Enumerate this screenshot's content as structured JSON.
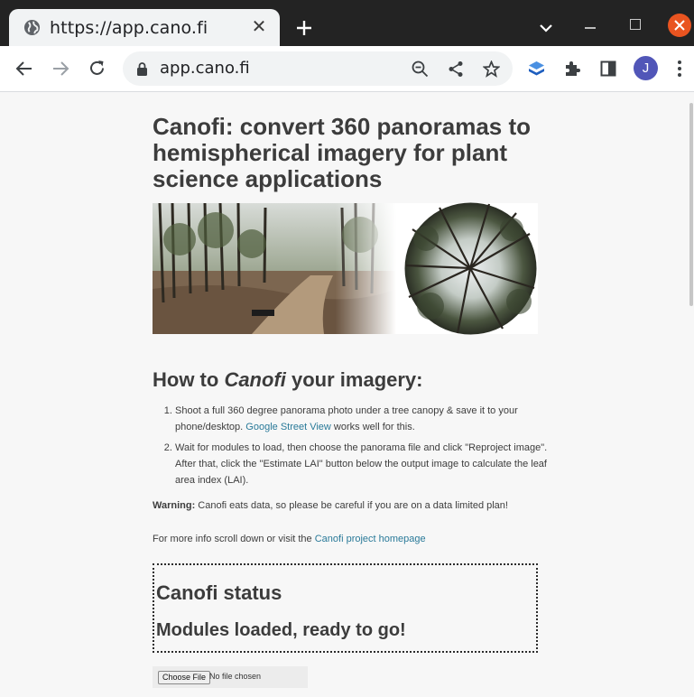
{
  "browser": {
    "tab_title": "https://app.cano.fi",
    "url": "app.cano.fi",
    "avatar_initial": "J",
    "colors": {
      "tabstrip": "#232323",
      "close_button": "#e95420",
      "avatar": "#5156b8"
    }
  },
  "page": {
    "title": "Canofi: convert 360 panoramas to hemispherical imagery for plant science applications",
    "howto": {
      "prefix": "How to ",
      "emphasis": "Canofi",
      "suffix": " your imagery:"
    },
    "steps": [
      {
        "text": "Shoot a full 360 degree panorama photo under a tree canopy & save it to your phone/desktop. ",
        "link": "Google Street View",
        "after": " works well for this."
      },
      {
        "text": "Wait for modules to load, then choose the panorama file and click \"Reproject image\". After that, click the \"Estimate LAI\" button below the output image to calculate the leaf area index (LAI)."
      }
    ],
    "warning": {
      "label": "Warning:",
      "text": " Canofi eats data, so please be careful if you are on a data limited plan!"
    },
    "moreinfo": {
      "text": "For more info scroll down or visit the ",
      "link": "Canofi project homepage"
    },
    "status": {
      "heading": "Canofi status",
      "message": "Modules loaded, ready to go!"
    },
    "file_input": {
      "button": "Choose File",
      "label": "No file chosen"
    },
    "colors": {
      "link": "#2a7a99",
      "text": "#3d3d3d"
    }
  }
}
